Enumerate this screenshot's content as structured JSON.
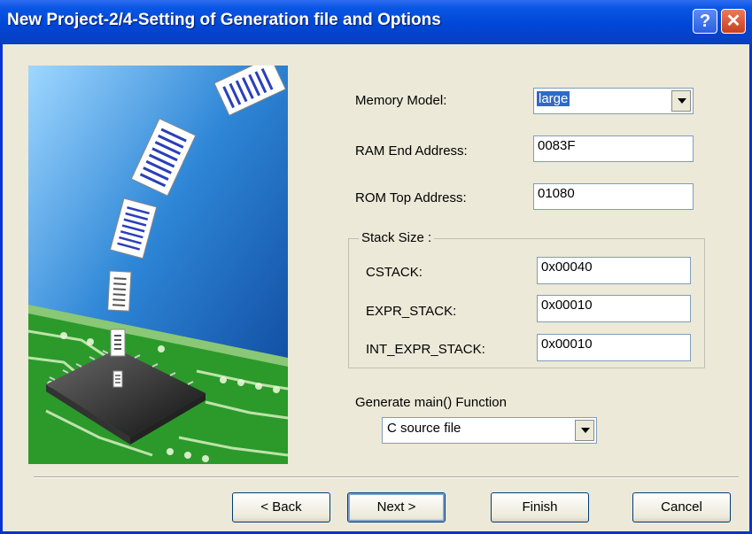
{
  "window": {
    "title": "New Project-2/4-Setting of Generation file and Options",
    "help_label": "?",
    "close_label": "✕"
  },
  "form": {
    "memory_model_label": "Memory Model:",
    "memory_model_value": "large",
    "ram_end_label": "RAM End Address:",
    "ram_end_value": "0083F",
    "rom_top_label": "ROM Top Address:",
    "rom_top_value": "01080",
    "stack_group_label": "Stack Size :",
    "cstack_label": "CSTACK:",
    "cstack_value": "0x00040",
    "expr_stack_label": "EXPR_STACK:",
    "expr_stack_value": "0x00010",
    "int_expr_stack_label": "INT_EXPR_STACK:",
    "int_expr_stack_value": "0x00010",
    "generate_main_label": "Generate main() Function",
    "generate_main_value": "C source file"
  },
  "buttons": {
    "back": "< Back",
    "next": "Next >",
    "finish": "Finish",
    "cancel": "Cancel"
  },
  "colors": {
    "titlebar": "#0a56e4",
    "window_bg": "#ece9d8",
    "picture_sky": "#0a4fa8",
    "circuit_board": "#2b9a2b"
  }
}
